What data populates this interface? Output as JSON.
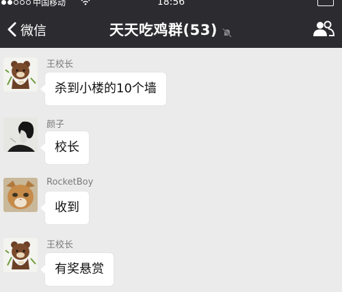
{
  "status": {
    "carrier": "中国移动",
    "time": "18:56"
  },
  "nav": {
    "back_label": "微信",
    "title": "天天吃鸡群(53)"
  },
  "icons": {
    "back": "chevron-left-icon",
    "mute": "bell-muted-icon",
    "members": "group-members-icon",
    "wifi": "wifi-icon"
  },
  "colors": {
    "header_bg": "#2c2c30",
    "chat_bg": "#ebebeb",
    "bubble_bg": "#ffffff"
  },
  "messages": [
    {
      "sender": "王校长",
      "text": "杀到小楼的10个墙",
      "avatar": "brown-bear-avatar"
    },
    {
      "sender": "颜子",
      "text": "校长",
      "avatar": "sketch-portrait-avatar"
    },
    {
      "sender": "RocketBoy",
      "text": "收到",
      "avatar": "cat-avatar"
    },
    {
      "sender": "王校长",
      "text": "有奖悬赏",
      "avatar": "brown-bear-avatar"
    }
  ]
}
